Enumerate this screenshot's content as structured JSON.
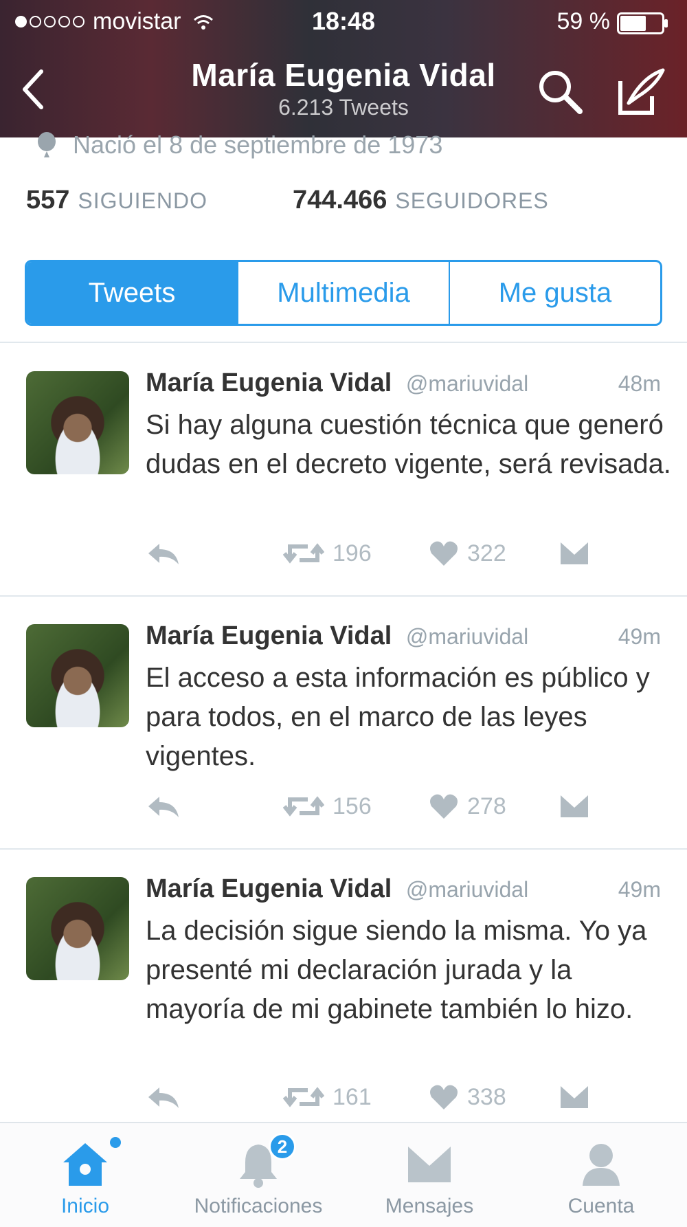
{
  "status_bar": {
    "carrier": "movistar",
    "time": "18:48",
    "battery": "59 %"
  },
  "nav": {
    "title": "María Eugenia Vidal",
    "subtitle": "6.213 Tweets"
  },
  "profile": {
    "birth": "Nació el 8 de septiembre de 1973",
    "following_count": "557",
    "following_label": "SIGUIENDO",
    "followers_count": "744.466",
    "followers_label": "SEGUIDORES"
  },
  "tabs": [
    {
      "label": "Tweets",
      "active": true
    },
    {
      "label": "Multimedia",
      "active": false
    },
    {
      "label": "Me gusta",
      "active": false
    }
  ],
  "tweets": [
    {
      "name": "María Eugenia Vidal",
      "handle": "@mariuvidal",
      "time": "48m",
      "text": "Si hay alguna cuestión técnica que generó dudas en el decreto vigente, será revisada.",
      "retweets": "196",
      "likes": "322"
    },
    {
      "name": "María Eugenia Vidal",
      "handle": "@mariuvidal",
      "time": "49m",
      "text": "El acceso a esta información es público y para todos, en el marco de las leyes vigentes.",
      "retweets": "156",
      "likes": "278"
    },
    {
      "name": "María Eugenia Vidal",
      "handle": "@mariuvidal",
      "time": "49m",
      "text": "La decisión sigue siendo la misma. Yo ya presenté mi declaración jurada y la mayoría de mi gabinete también lo hizo.",
      "retweets": "161",
      "likes": "338"
    }
  ],
  "tabbar": {
    "home": "Inicio",
    "notifications": "Notificaciones",
    "notifications_badge": "2",
    "messages": "Mensajes",
    "account": "Cuenta"
  },
  "icons": {
    "back": "chevron-left-icon",
    "search": "search-icon",
    "compose": "compose-icon",
    "reply": "reply-icon",
    "retweet": "retweet-icon",
    "like": "heart-icon",
    "dm": "envelope-icon"
  },
  "colors": {
    "accent": "#2a9bea",
    "muted": "#98a4ad"
  }
}
